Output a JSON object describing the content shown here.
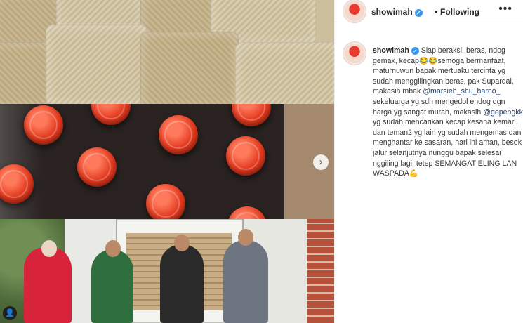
{
  "post": {
    "username": "showimah",
    "follow_status": "Following",
    "separator": "•",
    "more_icon": "more-options-icon",
    "caption": {
      "seg1": "Siap beraksi, beras, ndog gemak, kecap😂😂semoga bermanfaat, maturnuwun bapak mertuaku tercinta yg sudah menggilingkan beras, pak Supardal, makasih mbak ",
      "mention1": "@marsieh_shu_harno_",
      "seg2": " sekeluarga yg sdh mengedol endog dgn harga yg sangat murah, makasih ",
      "mention2": "@gepengkk",
      "seg3": " yg sudah mencarikan kecap kesana kemari, dan teman2 yg lain yg sudah mengemas dan menghantar ke sasaran, hari ini aman, besok jalur selanjutnya nunggu bapak selesai nggiling lagi, tetep SEMANGAT ELING LAN WASPADA💪"
    }
  },
  "media": {
    "next_glyph": "›",
    "user_tag_glyph": "👤"
  },
  "colors": {
    "verified": "#3897f0",
    "mention": "#1c3f6b",
    "text": "#262626"
  }
}
